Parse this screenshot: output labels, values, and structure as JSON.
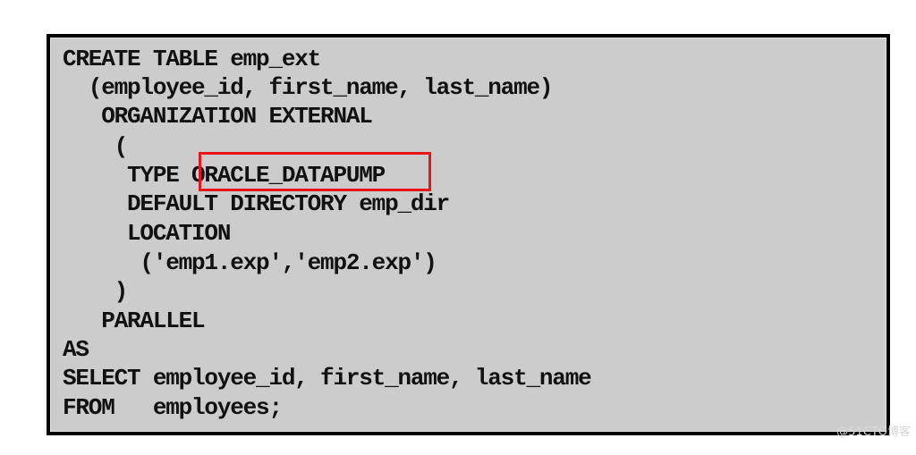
{
  "code": {
    "lines": [
      "CREATE TABLE emp_ext",
      "  (employee_id, first_name, last_name)",
      "   ORGANIZATION EXTERNAL",
      "    (",
      "     TYPE ORACLE_DATAPUMP",
      "     DEFAULT DIRECTORY emp_dir",
      "     LOCATION",
      "      ('emp1.exp','emp2.exp')",
      "    )",
      "   PARALLEL",
      "AS",
      "SELECT employee_id, first_name, last_name",
      "FROM   employees;"
    ],
    "highlighted": "ORACLE_DATAPUMP",
    "highlight_color": "#e8151b"
  },
  "watermark": "@51CTO博客"
}
